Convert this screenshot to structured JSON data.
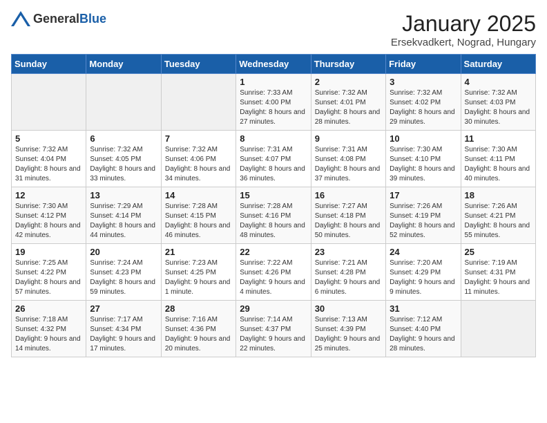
{
  "header": {
    "logo_general": "General",
    "logo_blue": "Blue",
    "title": "January 2025",
    "subtitle": "Ersekvadkert, Nograd, Hungary"
  },
  "weekdays": [
    "Sunday",
    "Monday",
    "Tuesday",
    "Wednesday",
    "Thursday",
    "Friday",
    "Saturday"
  ],
  "weeks": [
    [
      {
        "day": "",
        "sunrise": "",
        "sunset": "",
        "daylight": ""
      },
      {
        "day": "",
        "sunrise": "",
        "sunset": "",
        "daylight": ""
      },
      {
        "day": "",
        "sunrise": "",
        "sunset": "",
        "daylight": ""
      },
      {
        "day": "1",
        "sunrise": "Sunrise: 7:33 AM",
        "sunset": "Sunset: 4:00 PM",
        "daylight": "Daylight: 8 hours and 27 minutes."
      },
      {
        "day": "2",
        "sunrise": "Sunrise: 7:32 AM",
        "sunset": "Sunset: 4:01 PM",
        "daylight": "Daylight: 8 hours and 28 minutes."
      },
      {
        "day": "3",
        "sunrise": "Sunrise: 7:32 AM",
        "sunset": "Sunset: 4:02 PM",
        "daylight": "Daylight: 8 hours and 29 minutes."
      },
      {
        "day": "4",
        "sunrise": "Sunrise: 7:32 AM",
        "sunset": "Sunset: 4:03 PM",
        "daylight": "Daylight: 8 hours and 30 minutes."
      }
    ],
    [
      {
        "day": "5",
        "sunrise": "Sunrise: 7:32 AM",
        "sunset": "Sunset: 4:04 PM",
        "daylight": "Daylight: 8 hours and 31 minutes."
      },
      {
        "day": "6",
        "sunrise": "Sunrise: 7:32 AM",
        "sunset": "Sunset: 4:05 PM",
        "daylight": "Daylight: 8 hours and 33 minutes."
      },
      {
        "day": "7",
        "sunrise": "Sunrise: 7:32 AM",
        "sunset": "Sunset: 4:06 PM",
        "daylight": "Daylight: 8 hours and 34 minutes."
      },
      {
        "day": "8",
        "sunrise": "Sunrise: 7:31 AM",
        "sunset": "Sunset: 4:07 PM",
        "daylight": "Daylight: 8 hours and 36 minutes."
      },
      {
        "day": "9",
        "sunrise": "Sunrise: 7:31 AM",
        "sunset": "Sunset: 4:08 PM",
        "daylight": "Daylight: 8 hours and 37 minutes."
      },
      {
        "day": "10",
        "sunrise": "Sunrise: 7:30 AM",
        "sunset": "Sunset: 4:10 PM",
        "daylight": "Daylight: 8 hours and 39 minutes."
      },
      {
        "day": "11",
        "sunrise": "Sunrise: 7:30 AM",
        "sunset": "Sunset: 4:11 PM",
        "daylight": "Daylight: 8 hours and 40 minutes."
      }
    ],
    [
      {
        "day": "12",
        "sunrise": "Sunrise: 7:30 AM",
        "sunset": "Sunset: 4:12 PM",
        "daylight": "Daylight: 8 hours and 42 minutes."
      },
      {
        "day": "13",
        "sunrise": "Sunrise: 7:29 AM",
        "sunset": "Sunset: 4:14 PM",
        "daylight": "Daylight: 8 hours and 44 minutes."
      },
      {
        "day": "14",
        "sunrise": "Sunrise: 7:28 AM",
        "sunset": "Sunset: 4:15 PM",
        "daylight": "Daylight: 8 hours and 46 minutes."
      },
      {
        "day": "15",
        "sunrise": "Sunrise: 7:28 AM",
        "sunset": "Sunset: 4:16 PM",
        "daylight": "Daylight: 8 hours and 48 minutes."
      },
      {
        "day": "16",
        "sunrise": "Sunrise: 7:27 AM",
        "sunset": "Sunset: 4:18 PM",
        "daylight": "Daylight: 8 hours and 50 minutes."
      },
      {
        "day": "17",
        "sunrise": "Sunrise: 7:26 AM",
        "sunset": "Sunset: 4:19 PM",
        "daylight": "Daylight: 8 hours and 52 minutes."
      },
      {
        "day": "18",
        "sunrise": "Sunrise: 7:26 AM",
        "sunset": "Sunset: 4:21 PM",
        "daylight": "Daylight: 8 hours and 55 minutes."
      }
    ],
    [
      {
        "day": "19",
        "sunrise": "Sunrise: 7:25 AM",
        "sunset": "Sunset: 4:22 PM",
        "daylight": "Daylight: 8 hours and 57 minutes."
      },
      {
        "day": "20",
        "sunrise": "Sunrise: 7:24 AM",
        "sunset": "Sunset: 4:23 PM",
        "daylight": "Daylight: 8 hours and 59 minutes."
      },
      {
        "day": "21",
        "sunrise": "Sunrise: 7:23 AM",
        "sunset": "Sunset: 4:25 PM",
        "daylight": "Daylight: 9 hours and 1 minute."
      },
      {
        "day": "22",
        "sunrise": "Sunrise: 7:22 AM",
        "sunset": "Sunset: 4:26 PM",
        "daylight": "Daylight: 9 hours and 4 minutes."
      },
      {
        "day": "23",
        "sunrise": "Sunrise: 7:21 AM",
        "sunset": "Sunset: 4:28 PM",
        "daylight": "Daylight: 9 hours and 6 minutes."
      },
      {
        "day": "24",
        "sunrise": "Sunrise: 7:20 AM",
        "sunset": "Sunset: 4:29 PM",
        "daylight": "Daylight: 9 hours and 9 minutes."
      },
      {
        "day": "25",
        "sunrise": "Sunrise: 7:19 AM",
        "sunset": "Sunset: 4:31 PM",
        "daylight": "Daylight: 9 hours and 11 minutes."
      }
    ],
    [
      {
        "day": "26",
        "sunrise": "Sunrise: 7:18 AM",
        "sunset": "Sunset: 4:32 PM",
        "daylight": "Daylight: 9 hours and 14 minutes."
      },
      {
        "day": "27",
        "sunrise": "Sunrise: 7:17 AM",
        "sunset": "Sunset: 4:34 PM",
        "daylight": "Daylight: 9 hours and 17 minutes."
      },
      {
        "day": "28",
        "sunrise": "Sunrise: 7:16 AM",
        "sunset": "Sunset: 4:36 PM",
        "daylight": "Daylight: 9 hours and 20 minutes."
      },
      {
        "day": "29",
        "sunrise": "Sunrise: 7:14 AM",
        "sunset": "Sunset: 4:37 PM",
        "daylight": "Daylight: 9 hours and 22 minutes."
      },
      {
        "day": "30",
        "sunrise": "Sunrise: 7:13 AM",
        "sunset": "Sunset: 4:39 PM",
        "daylight": "Daylight: 9 hours and 25 minutes."
      },
      {
        "day": "31",
        "sunrise": "Sunrise: 7:12 AM",
        "sunset": "Sunset: 4:40 PM",
        "daylight": "Daylight: 9 hours and 28 minutes."
      },
      {
        "day": "",
        "sunrise": "",
        "sunset": "",
        "daylight": ""
      }
    ]
  ]
}
